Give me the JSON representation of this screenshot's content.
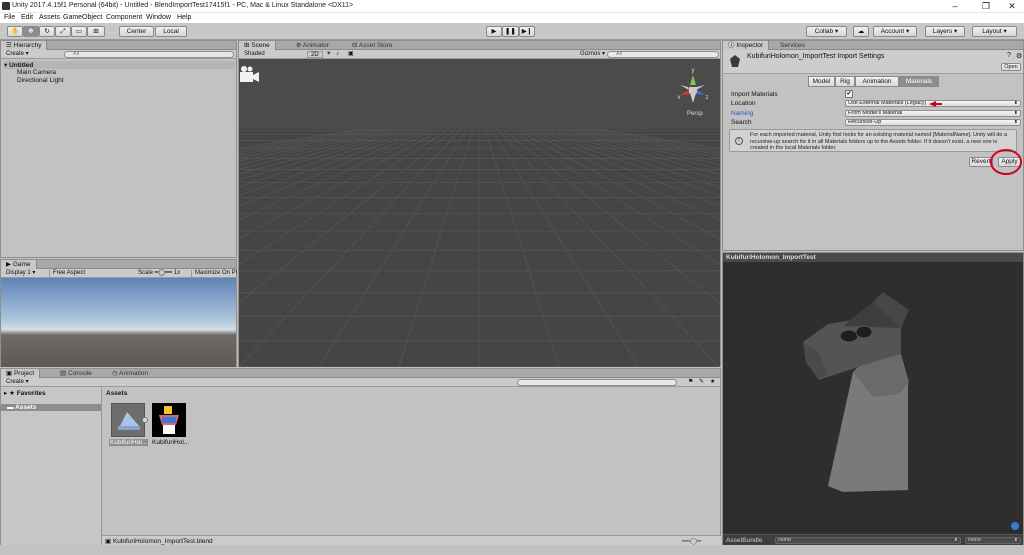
{
  "window": {
    "title": "Unity 2017.4.15f1 Personal (64bit) - Untitled - BlendImportTest17415f1 - PC, Mac & Linux Standalone <DX11>"
  },
  "menu": [
    "File",
    "Edit",
    "Assets",
    "GameObject",
    "Component",
    "Window",
    "Help"
  ],
  "toolbar": {
    "pivot_center": "Center",
    "pivot_local": "Local",
    "collab": "Collab",
    "account": "Account",
    "layers": "Layers",
    "layout": "Layout"
  },
  "hierarchy": {
    "tab": "Hierarchy",
    "create": "Create",
    "search_placeholder": "All",
    "scene_name": "Untitled",
    "items": [
      "Main Camera",
      "Directional Light"
    ]
  },
  "scene": {
    "tabs": [
      "Scene",
      "Animator",
      "Asset Store"
    ],
    "shading": "Shaded",
    "mode_2d": "2D",
    "gizmos": "Gizmos",
    "search_placeholder": "All",
    "persp": "Persp",
    "axis_y": "y",
    "axis_x": "x",
    "axis_z": "z"
  },
  "game": {
    "tab": "Game",
    "display": "Display 1",
    "aspect": "Free Aspect",
    "scale_label": "Scale",
    "scale_value": "1x",
    "maximize": "Maximize On Pl"
  },
  "project": {
    "tabs": [
      "Project",
      "Console",
      "Animation"
    ],
    "create": "Create",
    "favorites": "Favorites",
    "assets_folder": "Assets",
    "breadcrumb": "Assets",
    "items": [
      "KubifuriHol...",
      "KubifuriHol..."
    ],
    "status_path": "KubifuriHolomon_ImportTest.blend"
  },
  "inspector": {
    "tabs": [
      "Inspector",
      "Services"
    ],
    "header_title": "KubifuriHolomon_ImportTest Import Settings",
    "open_button": "Open",
    "sections": [
      "Model",
      "Rig",
      "Animation",
      "Materials"
    ],
    "fields": [
      {
        "label": "Import Materials",
        "value": "✔"
      },
      {
        "label": "Location",
        "value": "Use External Materials (Legacy)"
      },
      {
        "label": "Naming",
        "value": "From Model's Material"
      },
      {
        "label": "Search",
        "value": "Recursive-Up"
      }
    ],
    "help_text": "For each imported material, Unity first looks for an existing material named [MaterialName]. Unity will do a recursive-up search for it in all Materials folders up to the Assets folder. If it doesn't exist, a new one is created in the local Materials folder.",
    "revert": "Revert",
    "apply": "Apply"
  },
  "preview": {
    "title": "KubifuriHolomon_ImportTest",
    "assetbundle_label": "AssetBundle",
    "bundle_value": "None",
    "variant_value": "None"
  },
  "colors": {
    "annotation_circle": "#d0021b",
    "selected_tab": "#8d8d8d",
    "scene_bg": "#444444",
    "preview_bg": "#2e2e2e"
  }
}
